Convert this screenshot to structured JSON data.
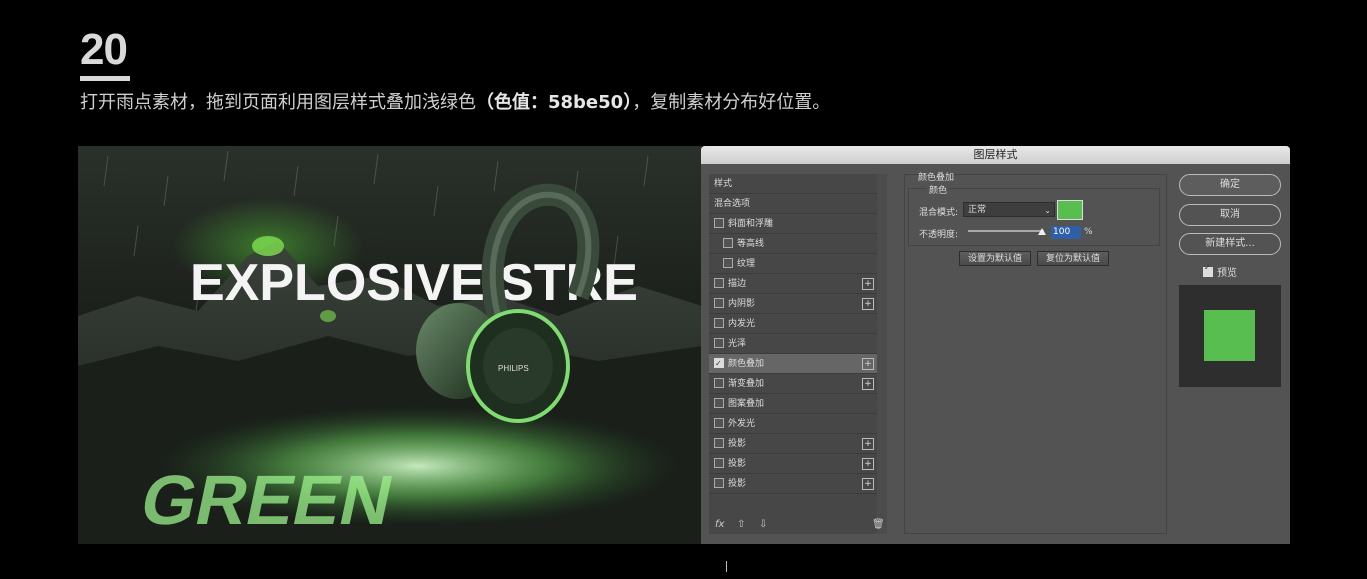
{
  "step": {
    "number": "20"
  },
  "instruction": {
    "text_before": "打开雨点素材，拖到页面利用图层样式叠加浅绿色",
    "bold": "（色值：58be50）",
    "text_after": "，复制素材分布好位置。"
  },
  "poster": {
    "headline": "EXPLOSIVE STRE",
    "bottom_word": "GREEN",
    "brand": "PHILIPS"
  },
  "dialog": {
    "title": "图层样式",
    "style_list": [
      {
        "label": "样式",
        "checkbox": false,
        "checked": false,
        "plus": false,
        "indent": false,
        "selected": false
      },
      {
        "label": "混合选项",
        "checkbox": false,
        "checked": false,
        "plus": false,
        "indent": false,
        "selected": false
      },
      {
        "label": "斜面和浮雕",
        "checkbox": true,
        "checked": false,
        "plus": false,
        "indent": false,
        "selected": false
      },
      {
        "label": "等高线",
        "checkbox": true,
        "checked": false,
        "plus": false,
        "indent": true,
        "selected": false
      },
      {
        "label": "纹理",
        "checkbox": true,
        "checked": false,
        "plus": false,
        "indent": true,
        "selected": false
      },
      {
        "label": "描边",
        "checkbox": true,
        "checked": false,
        "plus": true,
        "indent": false,
        "selected": false
      },
      {
        "label": "内阴影",
        "checkbox": true,
        "checked": false,
        "plus": true,
        "indent": false,
        "selected": false
      },
      {
        "label": "内发光",
        "checkbox": true,
        "checked": false,
        "plus": false,
        "indent": false,
        "selected": false
      },
      {
        "label": "光泽",
        "checkbox": true,
        "checked": false,
        "plus": false,
        "indent": false,
        "selected": false
      },
      {
        "label": "颜色叠加",
        "checkbox": true,
        "checked": true,
        "plus": true,
        "indent": false,
        "selected": true
      },
      {
        "label": "渐变叠加",
        "checkbox": true,
        "checked": false,
        "plus": true,
        "indent": false,
        "selected": false
      },
      {
        "label": "图案叠加",
        "checkbox": true,
        "checked": false,
        "plus": false,
        "indent": false,
        "selected": false
      },
      {
        "label": "外发光",
        "checkbox": true,
        "checked": false,
        "plus": false,
        "indent": false,
        "selected": false
      },
      {
        "label": "投影",
        "checkbox": true,
        "checked": false,
        "plus": true,
        "indent": false,
        "selected": false
      },
      {
        "label": "投影",
        "checkbox": true,
        "checked": false,
        "plus": true,
        "indent": false,
        "selected": false
      },
      {
        "label": "投影",
        "checkbox": true,
        "checked": false,
        "plus": true,
        "indent": false,
        "selected": false
      }
    ],
    "footer": {
      "fx": "fx",
      "up_icon": "arrow-up-icon",
      "down_icon": "arrow-down-icon",
      "trash_icon": "trash-icon"
    },
    "panel": {
      "title": "颜色叠加",
      "group": "颜色",
      "blend_mode_label": "混合模式:",
      "blend_mode_value": "正常",
      "color": "#58be50",
      "opacity_label": "不透明度:",
      "opacity_value": "100",
      "opacity_unit": "%",
      "set_default": "设置为默认值",
      "reset_default": "复位为默认值"
    },
    "buttons": {
      "ok": "确定",
      "cancel": "取消",
      "new_style": "新建样式..."
    },
    "preview": {
      "label": "预览",
      "checked": true,
      "color": "#58be50"
    }
  }
}
